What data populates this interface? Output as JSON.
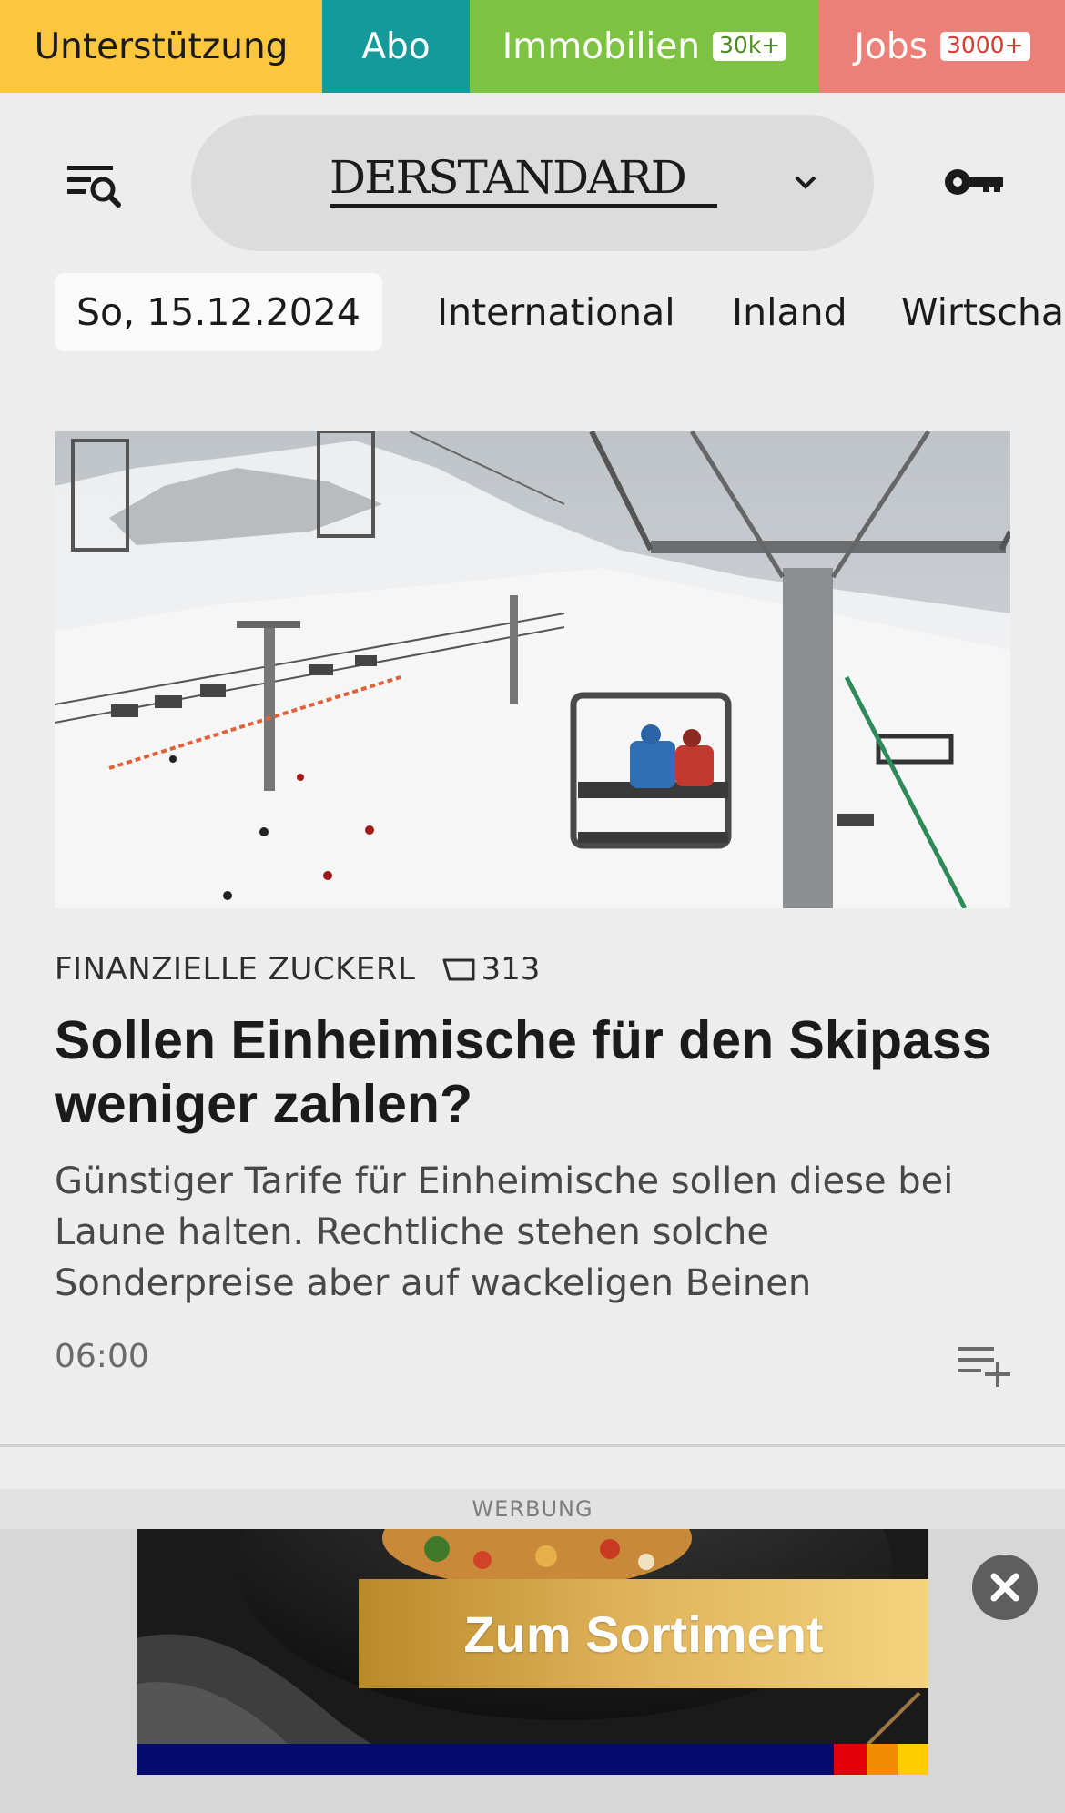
{
  "topbar": {
    "support_label": "Unterstützung",
    "abo_label": "Abo",
    "immobilien_label": "Immobilien",
    "immobilien_badge": "30k+",
    "jobs_label": "Jobs",
    "jobs_badge": "3000+",
    "colors": {
      "support": "#fcc63f",
      "abo": "#149a9a",
      "immobilien": "#7dc242",
      "jobs": "#ec7f78"
    }
  },
  "header": {
    "logo_text": "DERSTANDARD",
    "icons": {
      "menu": "menu-search-icon",
      "dropdown": "chevron-down-icon",
      "login": "key-icon"
    }
  },
  "nav": {
    "date": "So, 15.12.2024",
    "items": [
      {
        "label": "International"
      },
      {
        "label": "Inland"
      },
      {
        "label": "Wirtscha"
      }
    ]
  },
  "article": {
    "image_alt": "Sessellifte im Skigebiet mit Skifahrern auf verschneiter Piste",
    "kicker": "FINANZIELLE ZUCKERL",
    "comment_count": "313",
    "headline": "Sollen Einheimische für den Skipass weniger zahlen?",
    "teaser": "Günstiger Tarife für Einheimische sollen diese bei Laune halten. Rechtliche stehen solche Sonderpreise aber auf wackeligen Beinen",
    "time": "06:00",
    "icons": {
      "comments": "comment-icon",
      "read_later": "playlist-add-icon"
    }
  },
  "ad": {
    "label": "WERBUNG",
    "cta": "Zum Sortiment",
    "icons": {
      "close": "close-icon"
    }
  }
}
